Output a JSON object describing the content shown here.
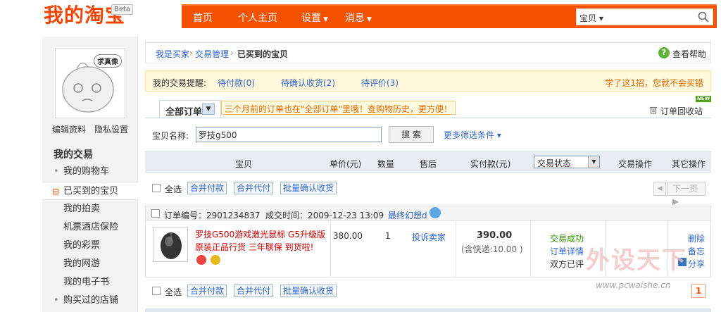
{
  "header": {
    "logo": "我的淘宝",
    "beta": "Beta",
    "nav": [
      {
        "label": "首页",
        "caret": false
      },
      {
        "label": "个人主页",
        "caret": false
      },
      {
        "label": "设置",
        "caret": true
      },
      {
        "label": "消息",
        "caret": true
      }
    ],
    "search": {
      "category": "宝贝 ▾",
      "placeholder": ""
    }
  },
  "sidebar": {
    "avatar_bubble": "求真像",
    "links": [
      "编辑资料",
      "隐私设置"
    ],
    "title": "我的交易",
    "items": [
      {
        "label": "我的购物车",
        "style": "dot"
      },
      {
        "label": "已买到的宝贝",
        "style": "active"
      },
      {
        "label": "我的拍卖",
        "style": "plain"
      },
      {
        "label": "机票酒店保险",
        "style": "plain"
      },
      {
        "label": "我的彩票",
        "style": "plain"
      },
      {
        "label": "我的网游",
        "style": "plain"
      },
      {
        "label": "我的电子书",
        "style": "plain"
      },
      {
        "label": "购买过的店铺",
        "style": "dot"
      }
    ]
  },
  "breadcrumb": {
    "items": [
      "我是买家",
      "交易管理"
    ],
    "sep": "›",
    "current": "已买到的宝贝",
    "help": "查看帮助"
  },
  "reminder": {
    "label": "我的交易提醒:",
    "links": [
      "待付款(0)",
      "待确认收货(2)",
      "待评价(3)"
    ],
    "tip": "学了这1招，您就不会买错"
  },
  "tabs": {
    "all": "全部订单",
    "hint": "三个月前的订单也在\"全部订单\"里哦！查购物历史，更方便！",
    "recycle": "订单回收站",
    "new_badge": "NEW"
  },
  "filter": {
    "label": "宝贝名称:",
    "value": "罗技g500",
    "search_btn": "搜 索",
    "more": "更多筛选条件 ▾"
  },
  "table": {
    "headers": {
      "item": "宝贝",
      "price": "单价(元)",
      "qty": "数量",
      "after_sale": "售后",
      "paid": "实付款(元)",
      "status": "交易状态",
      "trade_ops": "交易操作",
      "other_ops": "其它操作"
    }
  },
  "actions": {
    "select_all": "全选",
    "merge_pay": "合并付款",
    "merge_proxy": "合并代付",
    "batch_confirm": "批量确认收货",
    "prev": "◀",
    "next": "下一页 ▶"
  },
  "order": {
    "order_no": "订单编号：2901234837",
    "time": "成交时间：2009-12-23 13:09",
    "seller": "最终幻想d",
    "item_title": "罗技G500游戏激光鼠标 G5升级版 原装正品行货 三年联保 到货啦!",
    "price": "380.00",
    "qty": "1",
    "complain": "投诉卖家",
    "paid": "390.00",
    "shipping": "(含快递:10.00 )",
    "status_success": "交易成功",
    "status_detail": "订单详情",
    "status_rated": "双方已评",
    "op_delete": "删除",
    "op_note": "备忘",
    "op_share": "分享"
  },
  "pager": {
    "page": "1"
  },
  "watermark": {
    "big": "外设天下",
    "url": "www.pcwaishe.cn"
  },
  "colors": {
    "brand": "#f55200",
    "link": "#3366cc",
    "success": "#339900"
  }
}
